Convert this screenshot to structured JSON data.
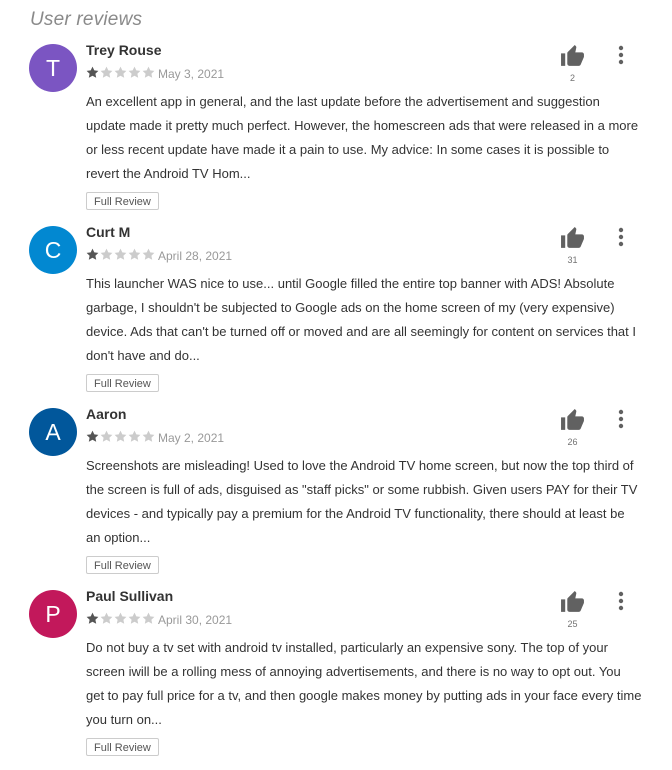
{
  "section_title": "User reviews",
  "colors": {
    "star_filled": "#555555",
    "star_empty": "#cccccc",
    "thumb": "#616161",
    "menu": "#616161"
  },
  "reviews": [
    {
      "initial": "T",
      "avatar_color": "#7b55c2",
      "author": "Trey Rouse",
      "rating": 1,
      "date": "May 3, 2021",
      "body": "An excellent app in general, and the last update before the advertisement and suggestion update made it pretty much perfect. However, the homescreen ads that were released in a more or less recent update have made it a pain to use. My advice: In some cases it is pos­sible to revert the Android TV Hom...",
      "helpful_count": "2",
      "full_review_label": "Full Review"
    },
    {
      "initial": "C",
      "avatar_color": "#0288d1",
      "author": "Curt M",
      "rating": 1,
      "date": "April 28, 2021",
      "body": "This launcher WAS nice to use... until Google filled the entire top banner with ADS! Absolute garbage, I shouldn't be subjected to Google ads on the home screen of my (very expensive) device. Ads that can't be turned off or moved and are all seemingly for content on services that I don't have and do...",
      "helpful_count": "31",
      "full_review_label": "Full Review"
    },
    {
      "initial": "A",
      "avatar_color": "#01579b",
      "author": "Aaron",
      "rating": 1,
      "date": "May 2, 2021",
      "body": "Screenshots are misleading! Used to love the Android TV home screen, but now the top third of the screen is full of ads, disguised as \"staff picks\" or some rubbish. Given users PAY for their TV devices - and typically pay a premium for the Android TV functionality, there should at least be an option...",
      "helpful_count": "26",
      "full_review_label": "Full Review"
    },
    {
      "initial": "P",
      "avatar_color": "#c2185b",
      "author": "Paul Sullivan",
      "rating": 1,
      "date": "April 30, 2021",
      "body": "Do not buy a tv set with android tv installed, particularly an expensive sony. The top of your screen iwill be a rolling mess of annoying advertisements, and there is no way to opt out. You get to pay full price for a tv, and then google makes money by putting ads in your face every time you turn on...",
      "helpful_count": "25",
      "full_review_label": "Full Review"
    }
  ]
}
